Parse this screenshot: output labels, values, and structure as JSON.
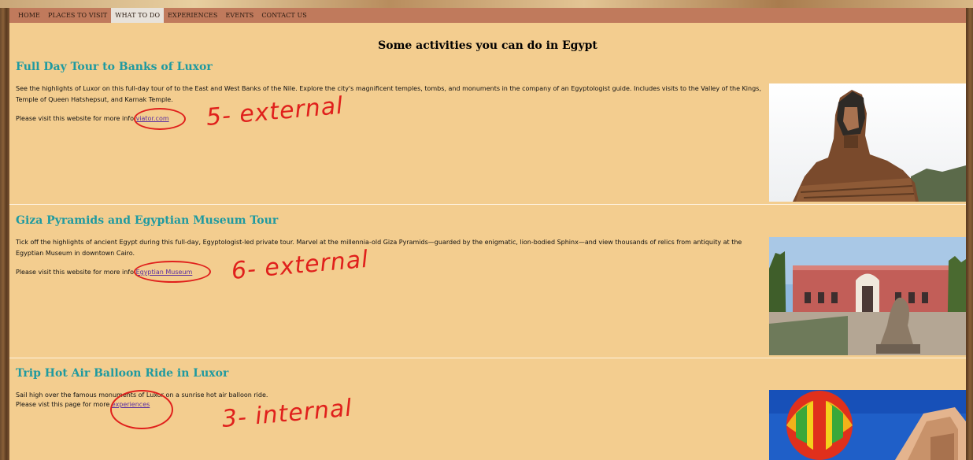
{
  "nav": {
    "items": [
      {
        "label": "HOME",
        "active": false
      },
      {
        "label": "PLACES TO VISIT",
        "active": false
      },
      {
        "label": "WHAT TO DO",
        "active": true
      },
      {
        "label": "EXPERIENCES",
        "active": false
      },
      {
        "label": "EVENTS",
        "active": false
      },
      {
        "label": "CONTACT US",
        "active": false
      }
    ]
  },
  "page": {
    "title": "Some activities you can do in Egypt"
  },
  "sections": [
    {
      "title": "Full Day Tour to Banks of Luxor",
      "description": "See the highlights of Luxor on this full-day tour of to the East and West Banks of the Nile. Explore the city's magnificent temples, tombs, and monuments in the company of an Egyptologist guide. Includes visits to the Valley of the Kings, Temple of Queen Hatshepsut, and Karnak Temple.",
      "more_prefix": "Please visit this website for more info ",
      "link_text": "viator.com",
      "annotation": "5- external",
      "image": "sphinx-statue-photo"
    },
    {
      "title": "Giza Pyramids and Egyptian Museum Tour",
      "description": "Tick off the highlights of ancient Egypt during this full-day, Egyptologist-led private tour. Marvel at the millennia-old Giza Pyramids—guarded by the enigmatic, lion-bodied Sphinx—and view thousands of relics from antiquity at the Egyptian Museum in downtown Cairo.",
      "more_prefix": "Please visit this website for more info ",
      "link_text": "Egyptian Museum",
      "annotation": "6- external",
      "image": "egyptian-museum-photo"
    },
    {
      "title": "Trip Hot Air Balloon Ride in Luxor",
      "description": "Sail high over the famous monuments of Luxor on a sunrise hot air balloon ride.",
      "more_prefix": "Please vist this page for more ",
      "link_text": "experiences",
      "annotation": "3- internal",
      "image": "hot-air-balloon-photo"
    }
  ],
  "colors": {
    "nav_bg": "#c07a5c",
    "content_bg": "#f3cd8f",
    "heading_teal": "#1f9aa0",
    "annotation_red": "#e0201c",
    "link_purple": "#5a2ea0"
  }
}
